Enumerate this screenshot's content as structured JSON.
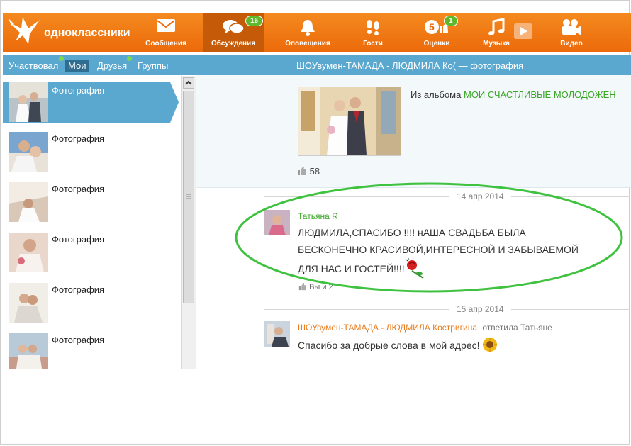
{
  "brand": {
    "name": "одноклассники",
    "colors": {
      "accent": "#ec6a0a",
      "panel": "#5aa8cf",
      "green": "#3aa626"
    }
  },
  "nav": [
    {
      "label": "Сообщения",
      "icon": "envelope-icon"
    },
    {
      "label": "Обсуждения",
      "icon": "chat-bubbles-icon",
      "badge": "16"
    },
    {
      "label": "Оповещения",
      "icon": "bell-icon"
    },
    {
      "label": "Гости",
      "icon": "footprints-icon"
    },
    {
      "label": "Оценки",
      "icon": "rating-five-icon",
      "badge": "1"
    },
    {
      "label": "Музыка",
      "icon": "music-note-icon"
    },
    {
      "label": "Видео",
      "icon": "video-camera-icon"
    }
  ],
  "tabs": [
    "Участвовал",
    "Мои",
    "Друзья",
    "Группы"
  ],
  "list": [
    "Фотография",
    "Фотография",
    "Фотография",
    "Фотография",
    "Фотография",
    "Фотография"
  ],
  "header": {
    "title": "ШОУвумен-ТАМАДА - ЛЮДМИЛА Ко( — фотография"
  },
  "photo": {
    "from_prefix": "Из альбома",
    "album": "МОИ СЧАСТЛИВЫЕ МОЛОДОЖЕН",
    "likes": "58"
  },
  "comments": [
    {
      "date": "14 апр 2014",
      "author": "Татьяна R",
      "lines": [
        "ЛЮДМИЛА,СПАСИБО !!!!    нАША СВАДЬБА БЫЛА",
        "БЕСКОНЕЧНО КРАСИВОЙ,ИНТЕРЕСНОЙ И ЗАБЫВАЕМОЙ",
        "ДЛЯ НАС И ГОСТЕЙ!!!!"
      ],
      "likes": "Вы и 2"
    },
    {
      "date": "15 апр 2014",
      "author": "ШОУвумен-ТАМАДА - ЛЮДМИЛА Костригина",
      "reply": "ответила Татьяне",
      "text": "Спасибо за добрые слова в мой адрес!"
    }
  ]
}
